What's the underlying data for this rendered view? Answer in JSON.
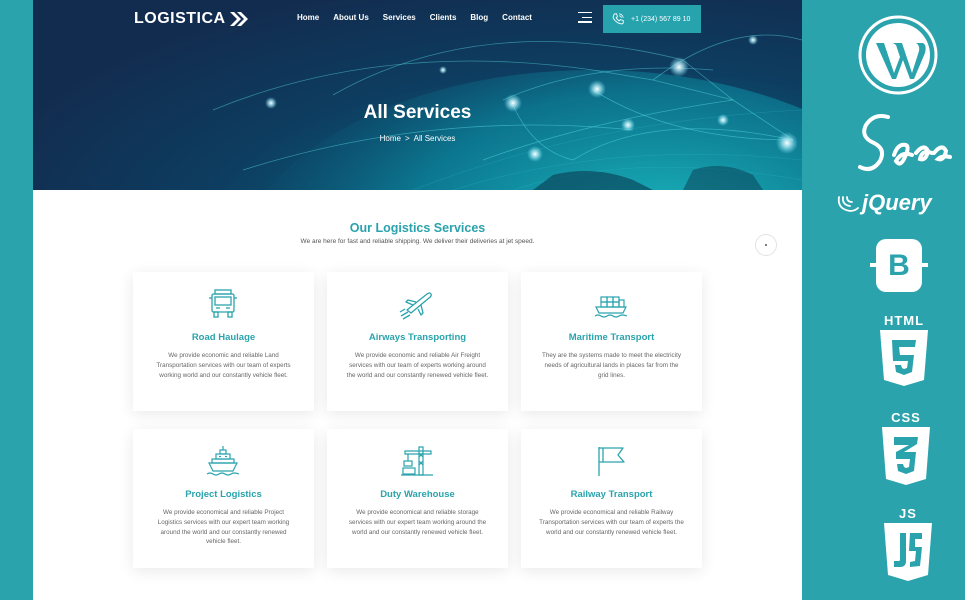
{
  "brand": {
    "logo_text": "LOGISTICA"
  },
  "nav": {
    "items": [
      "Home",
      "About Us",
      "Services",
      "Clients",
      "Blog",
      "Contact"
    ]
  },
  "phone": {
    "number": "+1 (234) 567 89 10"
  },
  "hero": {
    "title": "All Services",
    "breadcrumb_home": "Home",
    "breadcrumb_sep": ">",
    "breadcrumb_current": "All Services"
  },
  "section": {
    "title": "Our Logistics Services",
    "subtitle": "We are here for fast and reliable shipping. We deliver their deliveries at jet speed."
  },
  "cards": [
    {
      "icon": "truck-icon",
      "title": "Road Haulage",
      "desc": "We provide economic and reliable Land Transportation services with our team of experts working world and our constantly vehicle fleet."
    },
    {
      "icon": "airplane-icon",
      "title": "Airways Transporting",
      "desc": "We provide economic and reliable Air Freight services with our team of experts working around the world and our constantly renewed vehicle fleet."
    },
    {
      "icon": "cargo-ship-icon",
      "title": "Maritime Transport",
      "desc": "They are the systems made to meet the electricity needs of agricultural lands in places far from the grid lines."
    },
    {
      "icon": "ship-icon",
      "title": "Project Logistics",
      "desc": "We provide economical and reliable Project Logistics services with our expert team working around the world and our constantly renewed vehicle fleet."
    },
    {
      "icon": "crane-icon",
      "title": "Duty Warehouse",
      "desc": "We provide economical and reliable storage services with our expert team working around the world and our constantly renewed vehicle fleet."
    },
    {
      "icon": "flag-icon",
      "title": "Railway Transport",
      "desc": "We provide economical and reliable Railway Transportation services with our team of experts the world and our constantly renewed vehicle fleet."
    }
  ],
  "tech_badges": {
    "html": "HTML",
    "css": "CSS",
    "js": "JS",
    "bootstrap": "B",
    "jquery": "jQuery",
    "sass": "Sass"
  },
  "colors": {
    "accent": "#2aa3ad",
    "hero_dark": "#122c4f",
    "text_gray": "#666666"
  }
}
